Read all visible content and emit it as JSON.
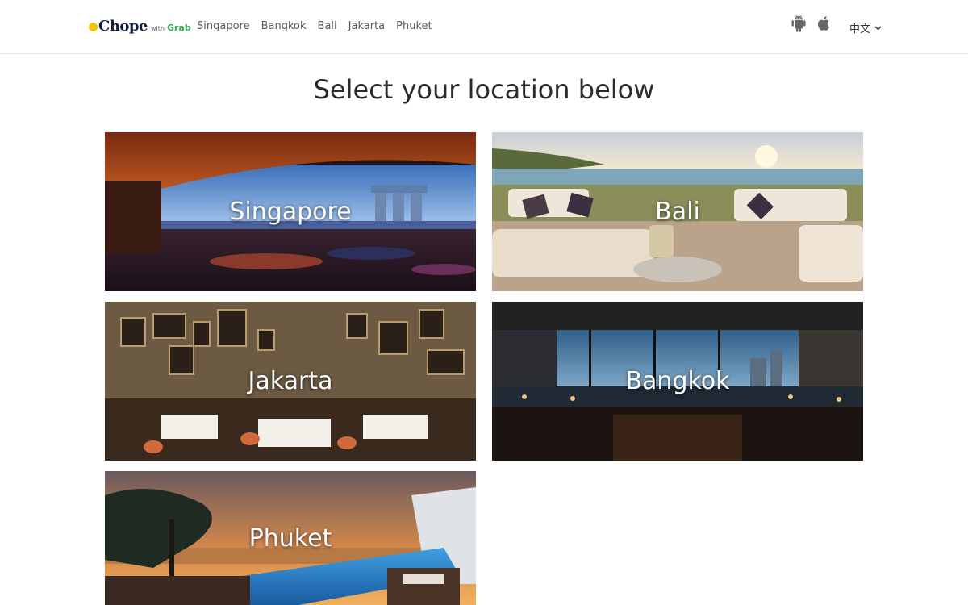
{
  "brand": {
    "name": "Chope",
    "with": "with",
    "partner": "Grab"
  },
  "nav": {
    "items": [
      "Singapore",
      "Bangkok",
      "Bali",
      "Jakarta",
      "Phuket"
    ]
  },
  "app_icons": [
    "android-icon",
    "apple-icon"
  ],
  "language": {
    "label": "中文"
  },
  "main": {
    "title": "Select your location below",
    "locations": [
      {
        "name": "Singapore"
      },
      {
        "name": "Bali"
      },
      {
        "name": "Jakarta"
      },
      {
        "name": "Bangkok"
      },
      {
        "name": "Phuket"
      }
    ]
  },
  "colors": {
    "logo_dot": "#f5c400",
    "logo_text": "#121f3a",
    "grab_green": "#2fb34a"
  }
}
